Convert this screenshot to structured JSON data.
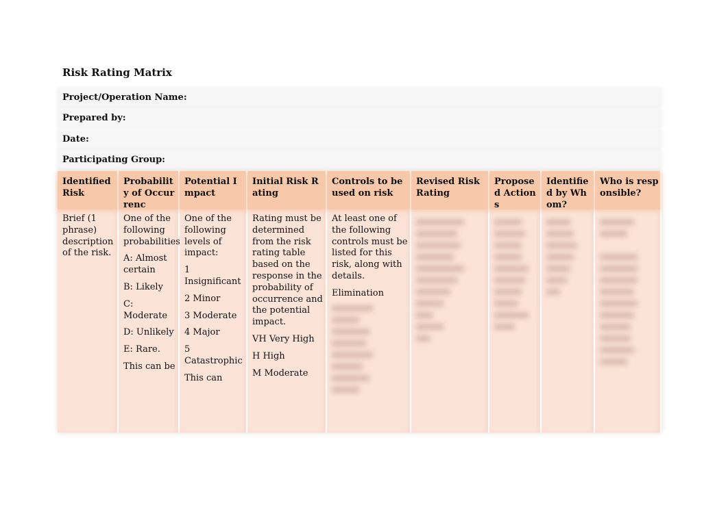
{
  "title": "Risk Rating Matrix",
  "info_fields": [
    "Project/Operation Name:",
    "Prepared by:",
    "Date:",
    "Participating Group:"
  ],
  "columns": [
    {
      "header": "Identified Risk",
      "body": [
        "Brief (1 phrase) description of the risk."
      ]
    },
    {
      "header": "Probability of Occurrenc",
      "body": [
        "One of the following probabilities:",
        "A: Almost certain",
        "B: Likely",
        "C: Moderate",
        "D: Unlikely",
        "E: Rare.",
        "This can be"
      ]
    },
    {
      "header": "Potential Impact",
      "body": [
        "One of the following levels of impact:",
        "1 Insignificant",
        "2 Minor",
        "3 Moderate",
        "4 Major",
        "5 Catastrophic",
        "This can"
      ]
    },
    {
      "header": "Initial Risk Rating",
      "body": [
        "Rating must be determined from the risk rating table based on the response in the probability of occurrence and the potential impact.",
        "VH Very High",
        "H High",
        "M Moderate"
      ]
    },
    {
      "header": "Controls to be used on risk",
      "body": [
        "At least one of the following controls must be listed for this risk, along with details.",
        "Elimination"
      ]
    },
    {
      "header": "Revised Risk Rating",
      "body": []
    },
    {
      "header": "Proposed Actions",
      "body": []
    },
    {
      "header": "Identified by Whom?",
      "body": []
    },
    {
      "header": "Who is responsible?",
      "body": []
    }
  ],
  "colors": {
    "header": "#f7c9aa",
    "cell": "#fce3d8"
  }
}
